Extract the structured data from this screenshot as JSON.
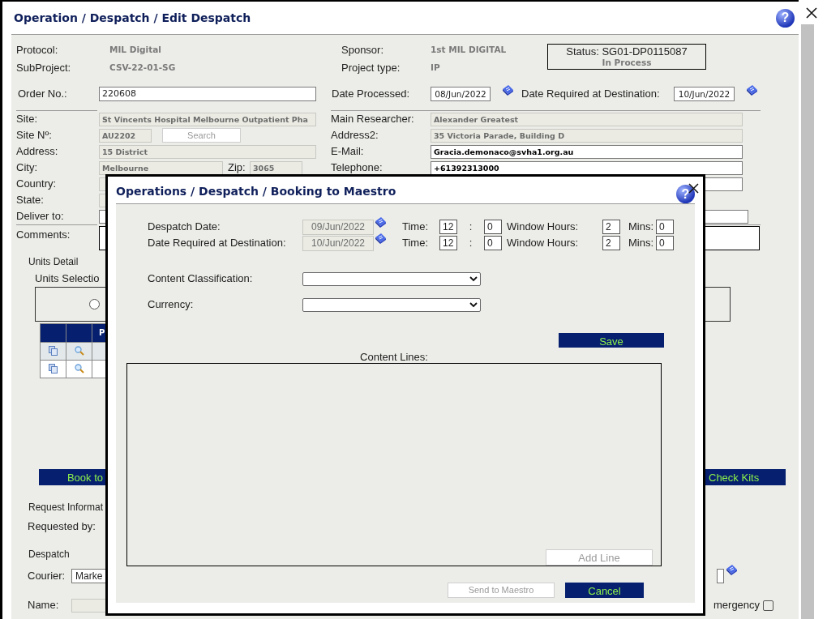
{
  "window": {
    "title": "Operation / Despatch / Edit Despatch",
    "help": "?"
  },
  "summary": [
    {
      "label": "Protocol:",
      "value": "MIL Digital"
    },
    {
      "label": "Sponsor:",
      "value": "1st MIL DIGITAL"
    },
    {
      "label": "SubProject:",
      "value": "CSV-22-01-SG"
    },
    {
      "label": "Project type:",
      "value": "IP"
    }
  ],
  "status": {
    "code": "Status: SG01-DP0115087",
    "state": "In Process"
  },
  "order": {
    "label": "Order No.:",
    "value": "220608"
  },
  "date_processed": {
    "label": "Date Processed:",
    "value": "08/Jun/2022"
  },
  "date_required": {
    "label": "Date Required at Destination:",
    "value": "10/Jun/2022"
  },
  "site": {
    "label": "Site:",
    "value": "St Vincents Hospital Melbourne Outpatient Pha",
    "disabled": true
  },
  "site_no": {
    "label": "Site Nº:",
    "value": "AU2202",
    "disabled": true
  },
  "search_button": {
    "label": "Search",
    "disabled": true
  },
  "address": {
    "label": "Address:",
    "value": "15 District",
    "disabled": true
  },
  "city": {
    "label": "City:",
    "value": "Melbourne",
    "disabled": true
  },
  "zip": {
    "label": "Zip:",
    "value": "3065",
    "disabled": true
  },
  "country": {
    "label": "Country:",
    "disabled": true
  },
  "state": {
    "label": "State:",
    "disabled": true
  },
  "deliver_to": {
    "label": "Deliver to:",
    "disabled": false
  },
  "main_researcher": {
    "label": "Main Researcher:",
    "value": "Alexander Greatest",
    "disabled": true
  },
  "address2": {
    "label": "Address2:",
    "value": "35 Victoria Parade, Building D",
    "disabled": true
  },
  "email": {
    "label": "E-Mail:",
    "value": "Gracia.demonaco@svha1.org.au",
    "disabled": false
  },
  "telephone": {
    "label": "Telephone:",
    "value": "+61392313000",
    "disabled": false
  },
  "comments": {
    "label": "Comments:"
  },
  "units": {
    "title": "Units Detail",
    "selection_label": "Units Selectio",
    "radio_selected": false,
    "table_header": "P"
  },
  "book_button": {
    "label": "Book to",
    "disabled": false
  },
  "check_kits_button": {
    "label": "Check Kits",
    "disabled": false
  },
  "request": {
    "title": "Request Informat",
    "requested_by": "Requested by:"
  },
  "despatch": {
    "title": "Despatch",
    "courier_label": "Courier:",
    "courier": "Marke",
    "name_label": "Name:",
    "emergency_label": "mergency",
    "emergency_checked": false
  },
  "booking": {
    "title": "Operations / Despatch / Booking to Maestro",
    "help": "?",
    "rows": [
      {
        "label": "Despatch Date:",
        "date": "09/Jun/2022",
        "time_label": "Time:",
        "hour": "12",
        "separator": ":",
        "minute": "0",
        "window_label": "Window Hours:",
        "window_hours": "2",
        "mins_label": "Mins:",
        "mins": "0"
      },
      {
        "label": "Date Required at Destination:",
        "date": "10/Jun/2022",
        "time_label": "Time:",
        "hour": "12",
        "separator": ":",
        "minute": "0",
        "window_label": "Window Hours:",
        "window_hours": "2",
        "mins_label": "Mins:",
        "mins": "0"
      }
    ],
    "selects": [
      {
        "label": "Content Classification:"
      },
      {
        "label": "Currency:"
      }
    ],
    "save_button": {
      "label": "Save",
      "disabled": false
    },
    "content_lines_label": "Content Lines:",
    "add_line_button": {
      "label": "Add Line",
      "disabled": true
    },
    "send_button": {
      "label": "Send to Maestro",
      "disabled": true
    },
    "cancel_button": {
      "label": "Cancel",
      "disabled": false
    }
  }
}
